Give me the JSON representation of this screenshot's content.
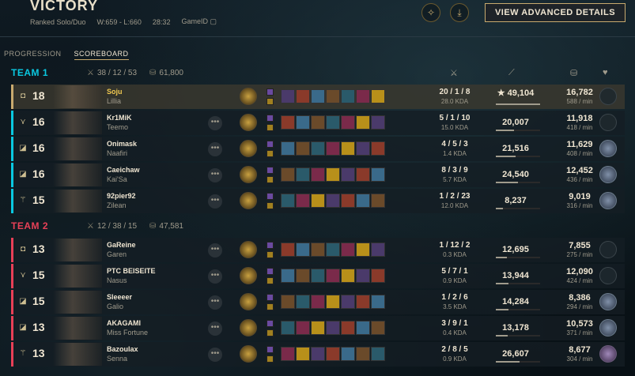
{
  "header": {
    "title": "VICTORY",
    "queue": "Ranked Solo/Duo",
    "record": "W:659 - L:660",
    "duration": "28:32",
    "game_id_label": "GameID",
    "advanced_button": "VIEW ADVANCED DETAILS"
  },
  "tabs": [
    {
      "label": "PROGRESSION",
      "active": false
    },
    {
      "label": "SCOREBOARD",
      "active": true
    }
  ],
  "teams": [
    {
      "name": "TEAM 1",
      "kda": "38 / 12 / 53",
      "gold": "61,800",
      "color": "#0ac8e0",
      "players": [
        {
          "position": "◘",
          "level": "18",
          "name": "Soju",
          "champion": "Lillia",
          "kda": "20 / 1 / 8",
          "kda_ratio": "28.0 KDA",
          "damage": "49,104",
          "damage_value": 49104,
          "top_damage": true,
          "gold": "16,782",
          "gpm": "588 / min",
          "self": true,
          "badge": "empty"
        },
        {
          "position": "⋎",
          "level": "16",
          "name": "Kr1MiK",
          "champion": "Teemo",
          "kda": "5 / 1 / 10",
          "kda_ratio": "15.0 KDA",
          "damage": "20,007",
          "damage_value": 20007,
          "gold": "11,918",
          "gpm": "418 / min",
          "badge": "empty"
        },
        {
          "position": "◪",
          "level": "16",
          "name": "Onimask",
          "champion": "Naafiri",
          "kda": "4 / 5 / 3",
          "kda_ratio": "1.4 KDA",
          "damage": "21,516",
          "damage_value": 21516,
          "gold": "11,629",
          "gpm": "408 / min",
          "badge": "filled"
        },
        {
          "position": "◪",
          "level": "16",
          "name": "Caeichaw",
          "champion": "Kai'Sa",
          "kda": "8 / 3 / 9",
          "kda_ratio": "5.7 KDA",
          "damage": "24,540",
          "damage_value": 24540,
          "gold": "12,452",
          "gpm": "436 / min",
          "badge": "filled"
        },
        {
          "position": "⚚",
          "level": "15",
          "name": "92pier92",
          "champion": "Zilean",
          "kda": "1 / 2 / 23",
          "kda_ratio": "12.0 KDA",
          "damage": "8,237",
          "damage_value": 8237,
          "gold": "9,019",
          "gpm": "316 / min",
          "badge": "filled"
        }
      ]
    },
    {
      "name": "TEAM 2",
      "kda": "12 / 38 / 15",
      "gold": "47,581",
      "color": "#e84057",
      "players": [
        {
          "position": "◘",
          "level": "13",
          "name": "GaReine",
          "champion": "Garen",
          "kda": "1 / 12 / 2",
          "kda_ratio": "0.3 KDA",
          "damage": "12,695",
          "damage_value": 12695,
          "gold": "7,855",
          "gpm": "275 / min",
          "badge": "empty"
        },
        {
          "position": "⋎",
          "level": "15",
          "name": "PTC BEISEITE",
          "champion": "Nasus",
          "kda": "5 / 7 / 1",
          "kda_ratio": "0.9 KDA",
          "damage": "13,944",
          "damage_value": 13944,
          "gold": "12,090",
          "gpm": "424 / min",
          "badge": "empty"
        },
        {
          "position": "◪",
          "level": "15",
          "name": "Sleeeer",
          "champion": "Galio",
          "kda": "1 / 2 / 6",
          "kda_ratio": "3.5 KDA",
          "damage": "14,284",
          "damage_value": 14284,
          "gold": "8,386",
          "gpm": "294 / min",
          "badge": "filled"
        },
        {
          "position": "◪",
          "level": "13",
          "name": "AKAGAMI",
          "champion": "Miss Fortune",
          "kda": "3 / 9 / 1",
          "kda_ratio": "0.4 KDA",
          "damage": "13,178",
          "damage_value": 13178,
          "gold": "10,573",
          "gpm": "371 / min",
          "badge": "filled"
        },
        {
          "position": "⚚",
          "level": "13",
          "name": "Bazoulax",
          "champion": "Senna",
          "kda": "2 / 8 / 5",
          "kda_ratio": "0.9 KDA",
          "damage": "26,607",
          "damage_value": 26607,
          "gold": "8,677",
          "gpm": "304 / min",
          "badge": "purple"
        }
      ]
    }
  ],
  "columns": {
    "kda_icon": "crossed-swords-icon",
    "damage_icon": "sword-icon",
    "gold_icon": "coins-icon",
    "badge_icon": "heart-icon"
  },
  "item_colors": [
    "#4a3a6a",
    "#8a3a2a",
    "#3a6a8a",
    "#6a4a2a",
    "#2a5a6a",
    "#7a2a4a",
    "#b8901a"
  ]
}
